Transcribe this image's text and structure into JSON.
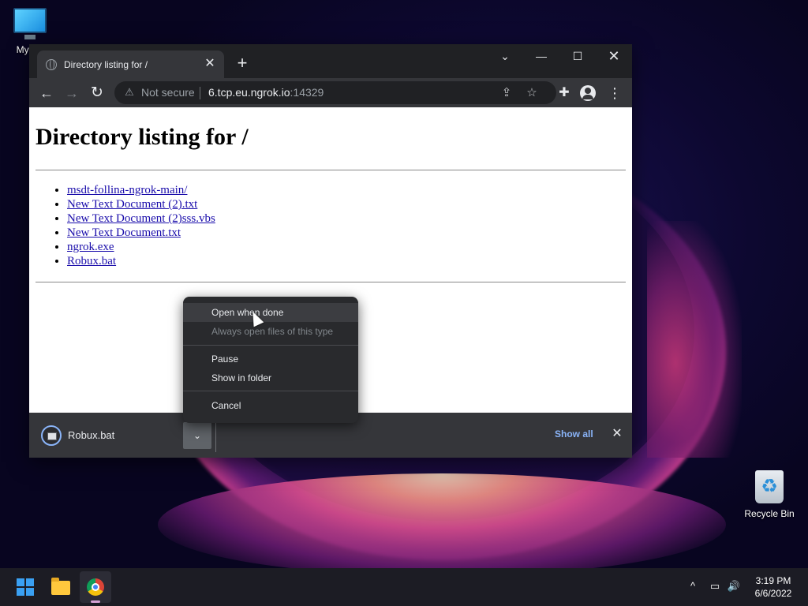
{
  "desktop": {
    "icons": [
      {
        "label": "My Co",
        "icon": "monitor-icon"
      },
      {
        "label": "Recycle Bin",
        "icon": "recycle-bin-icon"
      }
    ]
  },
  "browser": {
    "tab": {
      "title": "Directory listing for /",
      "close": "✕",
      "icon": "globe-icon"
    },
    "new_tab": "+",
    "window_controls": {
      "tab_search": "⌄",
      "minimize": "—",
      "maximize": "☐",
      "close": "✕"
    },
    "toolbar": {
      "back": "←",
      "forward": "→",
      "reload": "↻",
      "security_icon": "⚠",
      "security_label": "Not secure",
      "url_host": "6.tcp.eu.ngrok.io",
      "url_port": ":14329",
      "share": "⇪",
      "bookmark": "☆",
      "extensions": "✚",
      "menu": "⋮"
    }
  },
  "page": {
    "heading": "Directory listing for /",
    "files": [
      "msdt-follina-ngrok-main/",
      "New Text Document (2).txt",
      "New Text Document (2)sss.vbs",
      "New Text Document.txt",
      "ngrok.exe",
      "Robux.bat"
    ]
  },
  "context_menu": {
    "items": {
      "open_when_done": "Open when done",
      "always_open": "Always open files of this type",
      "pause": "Pause",
      "show_in_folder": "Show in folder",
      "cancel": "Cancel"
    }
  },
  "download_shelf": {
    "file_name": "Robux.bat",
    "chevron": "⌄",
    "show_all": "Show all",
    "close": "✕"
  },
  "taskbar": {
    "tray": {
      "chevron": "^",
      "network": "▭",
      "volume": "🔊"
    },
    "clock": {
      "time": "3:19 PM",
      "date": "6/6/2022"
    }
  },
  "colors": {
    "link": "#1a0dab",
    "accent_blue": "#8ab4f8",
    "chrome_dark": "#202124",
    "chrome_toolbar": "#35363a"
  }
}
